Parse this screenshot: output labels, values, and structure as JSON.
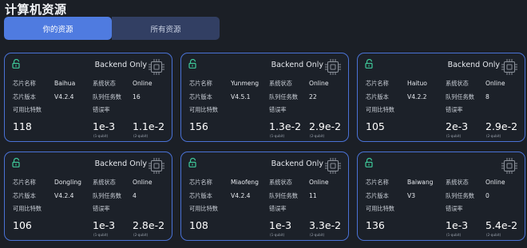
{
  "page_title": "计算机资源",
  "tabs": [
    {
      "label": "你的资源",
      "active": true
    },
    {
      "label": "所有资源",
      "active": false
    }
  ],
  "labels": {
    "chip_name": "芯片名称",
    "chip_version": "芯片版本",
    "system_status": "系统状态",
    "queue_tasks": "队列任务数",
    "available_bits": "可用比特数",
    "error_rate": "错误率",
    "qubit1": "(1-qubit)",
    "qubit2": "(2-qubit)"
  },
  "cards": [
    {
      "badge": "Backend Only",
      "name": "Baihua",
      "version": "V4.2.4",
      "status": "Online",
      "queue": "16",
      "bits": "118",
      "err1": "1e-3",
      "err2": "1.1e-2"
    },
    {
      "badge": "Backend Only",
      "name": "Yunmeng",
      "version": "V4.5.1",
      "status": "Online",
      "queue": "22",
      "bits": "156",
      "err1": "1.3e-2",
      "err2": "2.9e-2"
    },
    {
      "badge": "Backend Only",
      "name": "Haituo",
      "version": "V4.2.2",
      "status": "Online",
      "queue": "8",
      "bits": "105",
      "err1": "2e-3",
      "err2": "2.9e-2"
    },
    {
      "badge": "Backend Only",
      "name": "Dongling",
      "version": "V4.2.4",
      "status": "Online",
      "queue": "4",
      "bits": "106",
      "err1": "1e-3",
      "err2": "2.8e-2"
    },
    {
      "badge": "Backend Only",
      "name": "Miaofeng",
      "version": "V4.2.4",
      "status": "Online",
      "queue": "11",
      "bits": "108",
      "err1": "1e-3",
      "err2": "3.3e-2"
    },
    {
      "badge": "",
      "name": "Baiwang",
      "version": "V3",
      "status": "Online",
      "queue": "0",
      "bits": "136",
      "err1": "1e-3",
      "err2": "5.4e-2"
    }
  ],
  "colors": {
    "background": "#1b1f26",
    "card_border": "#4a72d6",
    "tab_active": "#4f7be0",
    "tab_inactive": "#323f63",
    "lock_icon": "#3fc99a"
  },
  "icons": {
    "lock": "unlock-icon",
    "chip": "chip-icon"
  }
}
